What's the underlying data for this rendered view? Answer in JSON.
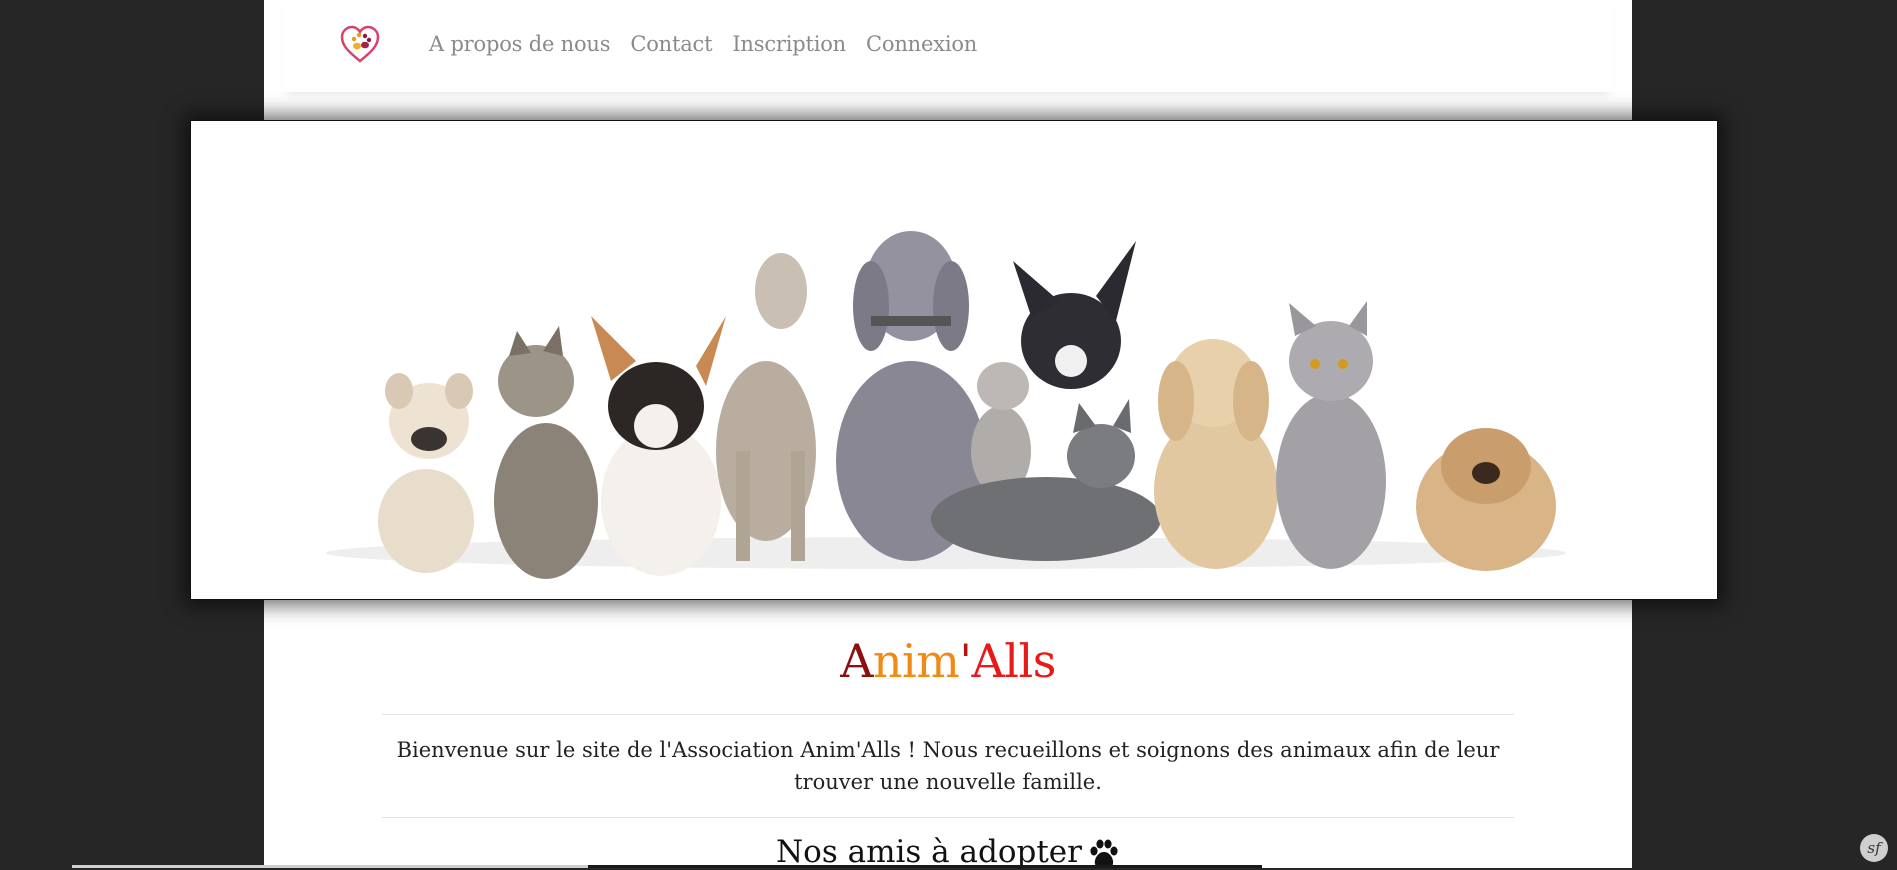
{
  "nav": {
    "logo_icon": "heart-paw-logo",
    "links": [
      "A propos de nous",
      "Contact",
      "Inscription",
      "Connexion"
    ]
  },
  "hero": {
    "image": "group-of-puppies-and-kittens-photo"
  },
  "brand": {
    "part_a": "A",
    "part_nim": "nim",
    "part_apos": "'",
    "part_alls": "Alls",
    "colors": {
      "a": "#8b1010",
      "nim": "#f08a14",
      "apos": "#b31515",
      "alls": "#e81919"
    }
  },
  "welcome_text": "Bienvenue sur le site de l'Association Anim'Alls ! Nous recueillons et soignons des animaux afin de leur trouver une nouvelle famille.",
  "adopt_title": "Nos amis à adopter",
  "adopt_icon": "paw-icon",
  "debug_badge": "sf"
}
